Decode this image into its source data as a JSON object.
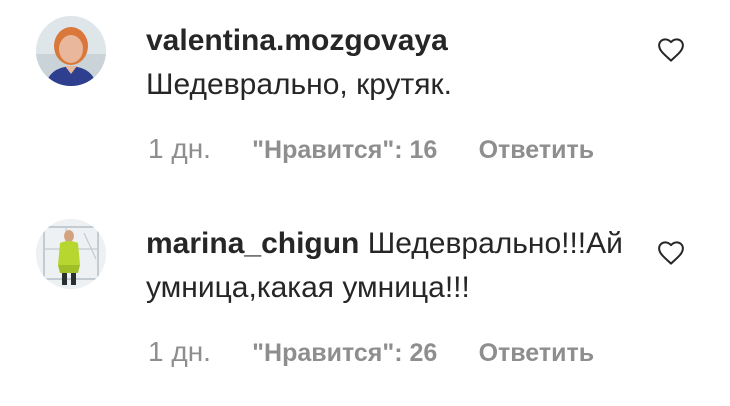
{
  "comments": [
    {
      "username": "valentina.mozgovaya",
      "text": "Шедеврально, крутяк.",
      "time": "1 дн.",
      "likes": "\"Нравится\": 16",
      "reply": "Ответить",
      "like_icon": "heart-outline-icon"
    },
    {
      "username": "marina_chigun",
      "text": "Шедеврально!!!Ай умница,какая умница!!!",
      "time": "1 дн.",
      "likes": "\"Нравится\": 26",
      "reply": "Ответить",
      "like_icon": "heart-outline-icon"
    }
  ],
  "colors": {
    "text": "#262626",
    "meta": "#8e8e8e",
    "background": "#ffffff"
  }
}
